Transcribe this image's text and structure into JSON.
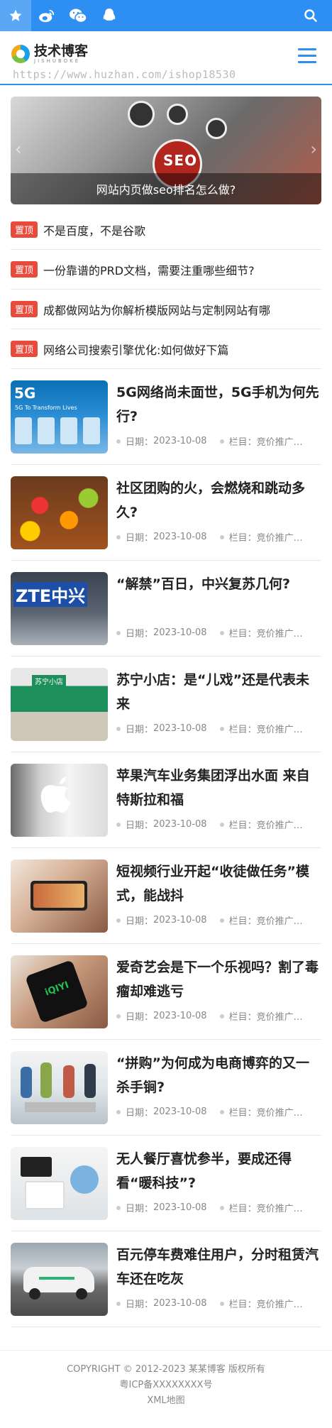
{
  "topbar": {
    "icons": [
      "star-icon",
      "weibo-icon",
      "wechat-icon",
      "qq-icon",
      "search-icon"
    ],
    "active_color": "#5aa8f5",
    "bg_color": "#2c8ff1"
  },
  "header": {
    "logo_cn": "技术博客",
    "logo_en": "JISHUBOKE",
    "watermark": "https://www.huzhan.com/ishop18530"
  },
  "banner": {
    "caption": "网站内页做seo排名怎么做?",
    "seo_text": "SEO"
  },
  "toplist": {
    "tag": "置顶",
    "items": [
      "不是百度，不是谷歌",
      "一份靠谱的PRD文档，需要注重哪些细节?",
      "成都做网站为你解析模版网站与定制网站有哪",
      "网络公司搜索引擎优化:如何做好下篇"
    ]
  },
  "posts": {
    "date_label": "日期：",
    "category_label": "栏目：",
    "items": [
      {
        "title": "5G网络尚未面世，5G手机为何先行?",
        "date": "2023-10-08",
        "category": "竞价推广…",
        "thumb_text": "5G To Transform Lives"
      },
      {
        "title": "社区团购的火，会燃烧和跳动多久?",
        "date": "2023-10-08",
        "category": "竞价推广…",
        "thumb_text": ""
      },
      {
        "title": "“解禁”百日，中兴复苏几何?",
        "date": "2023-10-08",
        "category": "竞价推广…",
        "thumb_text": "ZTE中兴"
      },
      {
        "title": "苏宁小店：是“儿戏”还是代表未来",
        "date": "2023-10-08",
        "category": "竞价推广…",
        "thumb_text": "苏宁小店"
      },
      {
        "title": "苹果汽车业务集团浮出水面 来自特斯拉和福",
        "date": "2023-10-08",
        "category": "竞价推广…",
        "thumb_text": ""
      },
      {
        "title": "短视频行业开起“收徒做任务”模式，能战抖",
        "date": "2023-10-08",
        "category": "竞价推广…",
        "thumb_text": ""
      },
      {
        "title": "爱奇艺会是下一个乐视吗？割了毒瘤却难逃亏",
        "date": "2023-10-08",
        "category": "竞价推广…",
        "thumb_text": "iQIYI"
      },
      {
        "title": "“拼购”为何成为电商博弈的又一杀手锏?",
        "date": "2023-10-08",
        "category": "竞价推广…",
        "thumb_text": ""
      },
      {
        "title": "无人餐厅喜忧参半，要成还得看“暖科技”?",
        "date": "2023-10-08",
        "category": "竞价推广…",
        "thumb_text": ""
      },
      {
        "title": "百元停车费难住用户，分时租赁汽车还在吃灰",
        "date": "2023-10-08",
        "category": "竞价推广…",
        "thumb_text": ""
      }
    ]
  },
  "footer": {
    "copyright": "COPYRIGHT © 2012-2023 某某博客 版权所有",
    "icp": "粤ICP备XXXXXXXX号",
    "sitemap": "XML地图"
  }
}
